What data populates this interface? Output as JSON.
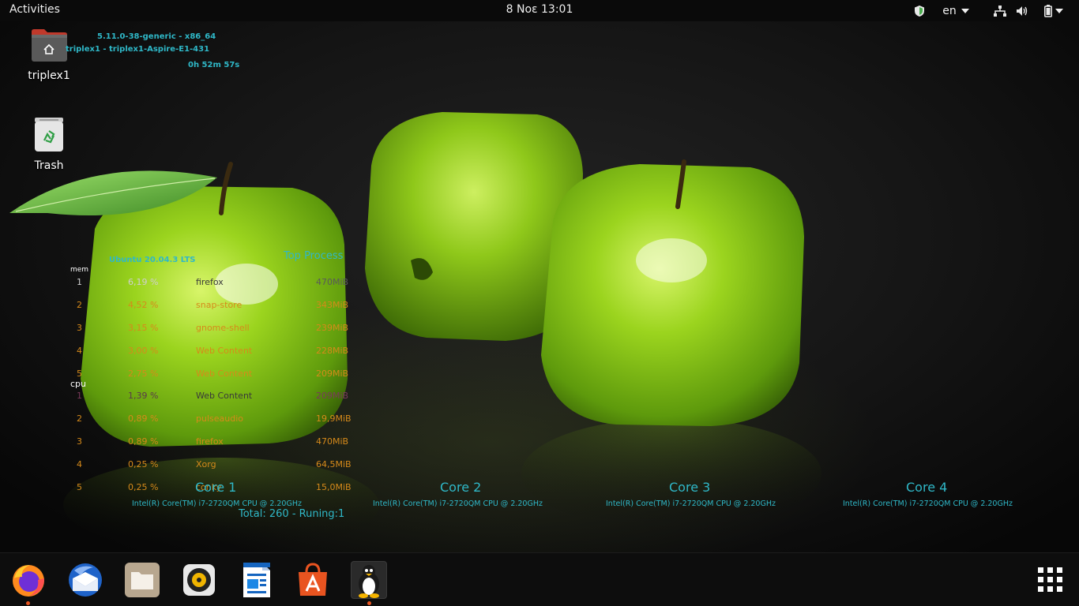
{
  "topbar": {
    "activities": "Activities",
    "clock": "8 Νοε  13:01",
    "keyboard_layout": "en",
    "icons": [
      "shield-icon",
      "network-icon",
      "volume-icon",
      "battery-icon"
    ]
  },
  "desktop": {
    "icons": [
      {
        "label": "triplex1",
        "icon": "home-folder-icon"
      },
      {
        "label": "Trash",
        "icon": "trash-icon"
      }
    ]
  },
  "conky": {
    "kernel": "5.11.0-38-generic - x86_64",
    "host": "triplex1 - triplex1-Aspire-E1-431",
    "uptime": "0h 52m 57s",
    "os": "Ubuntu 20.04.3 LTS",
    "top_title": "Top Process",
    "mem_label": "mem",
    "cpu_label": "cpu",
    "mem_rows": [
      {
        "rank": "1",
        "pct": "6,19 %",
        "name": "firefox",
        "mem": "470MiB"
      },
      {
        "rank": "2",
        "pct": "4,52 %",
        "name": "snap-store",
        "mem": "343MiB"
      },
      {
        "rank": "3",
        "pct": "3,15 %",
        "name": "gnome-shell",
        "mem": "239MiB"
      },
      {
        "rank": "4",
        "pct": "3,00 %",
        "name": "Web Content",
        "mem": "228MiB"
      },
      {
        "rank": "5",
        "pct": "2,75 %",
        "name": "Web Content",
        "mem": "209MiB"
      }
    ],
    "cpu_rows": [
      {
        "rank": "1",
        "pct": "1,39 %",
        "name": "Web Content",
        "mem": "209MiB"
      },
      {
        "rank": "2",
        "pct": "0,89 %",
        "name": "pulseaudio",
        "mem": "19,9MiB"
      },
      {
        "rank": "3",
        "pct": "0,89 %",
        "name": "firefox",
        "mem": "470MiB"
      },
      {
        "rank": "4",
        "pct": "0,25 %",
        "name": "Xorg",
        "mem": "64,5MiB"
      },
      {
        "rank": "5",
        "pct": "0,25 %",
        "name": "conky",
        "mem": "15,0MiB"
      }
    ],
    "cores": [
      {
        "title": "Core 1",
        "cpu": "Intel(R) Core(TM) i7-2720QM CPU @ 2.20GHz"
      },
      {
        "title": "Core 2",
        "cpu": "Intel(R) Core(TM) i7-2720QM CPU @ 2.20GHz"
      },
      {
        "title": "Core 3",
        "cpu": "Intel(R) Core(TM) i7-2720QM CPU @ 2.20GHz"
      },
      {
        "title": "Core 4",
        "cpu": "Intel(R) Core(TM) i7-2720QM CPU @ 2.20GHz"
      }
    ],
    "total": "Total: 260 - Runing:1"
  },
  "dock": {
    "items": [
      {
        "name": "Firefox",
        "icon": "firefox-icon",
        "running": true
      },
      {
        "name": "Thunderbird",
        "icon": "thunderbird-icon",
        "running": false
      },
      {
        "name": "Files",
        "icon": "files-icon",
        "running": false
      },
      {
        "name": "Rhythmbox",
        "icon": "rhythmbox-icon",
        "running": false
      },
      {
        "name": "LibreOffice Writer",
        "icon": "writer-icon",
        "running": false
      },
      {
        "name": "Ubuntu Software",
        "icon": "software-icon",
        "running": false
      },
      {
        "name": "Conky",
        "icon": "tux-icon",
        "running": true
      }
    ],
    "show_apps_icon": "grid-icon"
  },
  "colors": {
    "accent_cyan": "#2fb8c8",
    "orange": "#d68a1a",
    "ubuntu_orange": "#e95420",
    "apple_green": "#8ccc1a"
  }
}
